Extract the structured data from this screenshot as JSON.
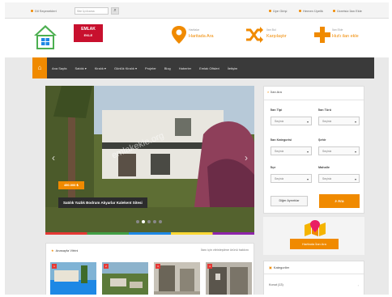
{
  "topbar": {
    "lang": "Dil Seçenekleri",
    "search_placeholder": "Site İçi Arama",
    "login": "Üye Girişi",
    "register": "Hemen Üyelik",
    "free_ad": "Ücretsiz İlan Ekle"
  },
  "header": {
    "logo_title": "EMLAK",
    "logo_sub": "EKLE",
    "item1_small": "Haritalar",
    "item1_big": "Haritada Ara",
    "item2_small": "İlan Bul",
    "item2_big": "Karşılaştır",
    "item3_small": "İlan Ekle",
    "item3_big": "Hızlı ilan ekle"
  },
  "nav": {
    "home_icon": "home-icon",
    "items": [
      "Ana Sayfa",
      "Satılık ▾",
      "Kiralık ▾",
      "Günlük Kiralık ▾",
      "Projeler",
      "Blog",
      "Haberler",
      "Emlak Ofisleri",
      "İletişim"
    ]
  },
  "slider": {
    "price": "450.000 ₺",
    "caption": "Satılık Yazlık Bodrum Akyarlar Kalekent Sitesi",
    "watermark": "emlakekle.org",
    "prev": "‹",
    "next": "›",
    "dots": 5,
    "active_dot": 1
  },
  "search": {
    "title": "İlan Ara",
    "labels": [
      "İlan Tipi",
      "İlan Türü",
      "İlan Kategorisi",
      "Şehir",
      "İlçe",
      "Mahalle"
    ],
    "placeholders": [
      "Seçiniz",
      "Seçiniz",
      "Seçiniz",
      "Seçiniz",
      "Seçiniz",
      "Seçiniz"
    ],
    "detail_button": "Diğer Ayrıntılar",
    "search_button": "Ara"
  },
  "mapad": {
    "button": "Haritada İlan Ara"
  },
  "listing": {
    "title": "Anasayfa Vitrini",
    "right": "İlanı için vitrinleştime ürünü hakkını",
    "badges": [
      "1",
      "2",
      "3",
      "4"
    ]
  },
  "categories": {
    "title": "Kategoriler",
    "first_item": "Konut (13)",
    "arrow": "›"
  },
  "colors": {
    "accent": "#f08a00",
    "nav": "#3a3a3a",
    "logo": "#c8102e"
  }
}
